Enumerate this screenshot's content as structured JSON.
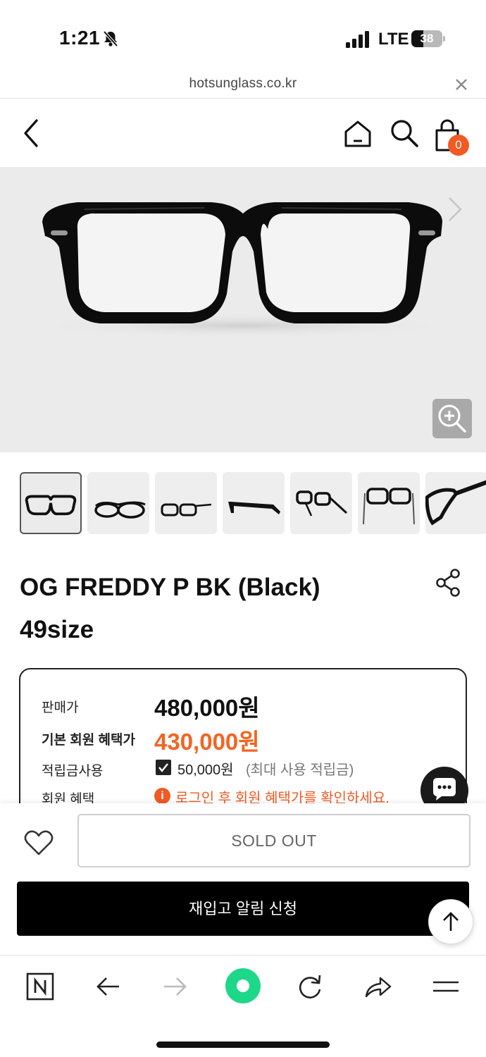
{
  "status_bar": {
    "time": "1:21",
    "network": "LTE",
    "battery": "38",
    "battery_level": 0.38
  },
  "browser": {
    "url": "hotsunglass.co.kr"
  },
  "header": {
    "cart_count": "0"
  },
  "product": {
    "title_line1": "OG FREDDY P BK (Black)",
    "title_line2": "49size",
    "thumbnail_count": 7,
    "active_thumbnail": 1
  },
  "pricing": {
    "sale_label": "판매가",
    "sale_price": "480,000원",
    "member_label": "기본 회원 혜택가",
    "member_price": "430,000원",
    "points_label": "적립금사용",
    "points_value": "50,000원",
    "points_note": "(최대 사용 적립금)",
    "benefit_label": "회원 혜택",
    "benefit_note": "로그인 후 회원 혜택가를 확인하세요."
  },
  "actions": {
    "sold_out": "SOLD OUT",
    "restock": "재입고 알림 신청"
  },
  "colors": {
    "accent": "#f15a22",
    "primary": "#000000",
    "hero_bg": "#ebebeb"
  },
  "icons": [
    "bell-off-icon",
    "signal-icon",
    "close-icon",
    "back-arrow-icon",
    "home-icon",
    "search-icon",
    "cart-icon",
    "chevron-right-icon",
    "zoom-in-icon",
    "share-icon",
    "info-icon",
    "chat-icon",
    "heart-icon",
    "arrow-up-icon",
    "naver-icon",
    "refresh-icon",
    "menu-icon"
  ]
}
